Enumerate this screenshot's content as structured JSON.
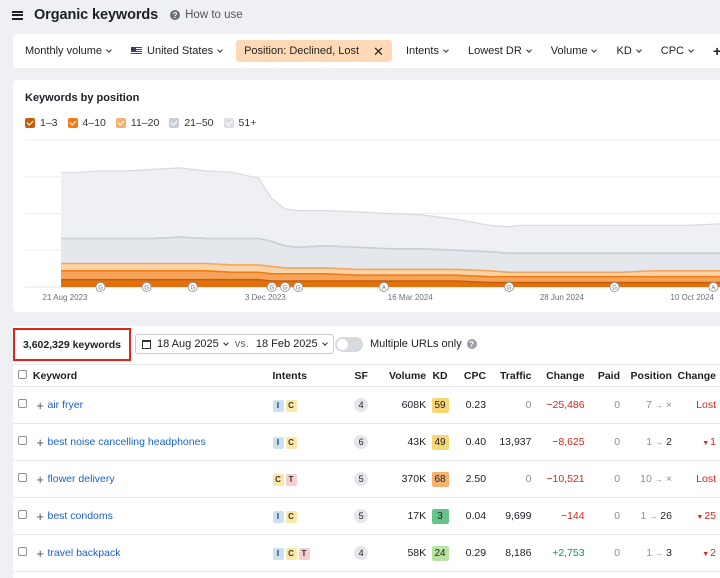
{
  "header": {
    "title": "Organic keywords",
    "how_to_use": "How to use"
  },
  "filters": {
    "monthly_volume": "Monthly volume",
    "country": "United States",
    "position_filter": "Position: Declined, Lost",
    "intents": "Intents",
    "lowest_dr": "Lowest DR",
    "volume": "Volume",
    "kd": "KD",
    "cpc": "CPC",
    "add_more": "A"
  },
  "chart_data": {
    "type": "area",
    "title": "Keywords by position",
    "legend": [
      {
        "name": "1–3",
        "color": "#c6600b"
      },
      {
        "name": "4–10",
        "color": "#ef7c16"
      },
      {
        "name": "11–20",
        "color": "#f7b26a"
      },
      {
        "name": "21–50",
        "color": "#c8ced6"
      },
      {
        "name": "51+",
        "color": "#dde1e6"
      }
    ],
    "x_ticks": [
      "21 Aug 2023",
      "3 Dec 2023",
      "16 Mar 2024",
      "28 Jun 2024",
      "10 Oct 2024"
    ],
    "x": [
      0,
      0.03,
      0.06,
      0.1,
      0.14,
      0.18,
      0.22,
      0.26,
      0.3,
      0.32,
      0.34,
      0.36,
      0.4,
      0.45,
      0.5,
      0.55,
      0.6,
      0.65,
      0.68,
      0.7,
      0.75,
      0.8,
      0.85,
      0.9,
      0.95,
      1.0
    ],
    "series": [
      {
        "name": "51+",
        "values": [
          0.78,
          0.78,
          0.79,
          0.79,
          0.8,
          0.81,
          0.79,
          0.78,
          0.74,
          0.6,
          0.53,
          0.52,
          0.52,
          0.51,
          0.5,
          0.49,
          0.46,
          0.42,
          0.41,
          0.42,
          0.42,
          0.42,
          0.42,
          0.42,
          0.42,
          0.43
        ]
      },
      {
        "name": "21–50",
        "values": [
          0.33,
          0.33,
          0.33,
          0.33,
          0.33,
          0.34,
          0.33,
          0.33,
          0.33,
          0.31,
          0.28,
          0.27,
          0.28,
          0.27,
          0.26,
          0.26,
          0.25,
          0.24,
          0.23,
          0.23,
          0.23,
          0.23,
          0.23,
          0.23,
          0.23,
          0.23
        ]
      },
      {
        "name": "11–20",
        "values": [
          0.16,
          0.16,
          0.16,
          0.16,
          0.16,
          0.16,
          0.16,
          0.15,
          0.15,
          0.14,
          0.13,
          0.13,
          0.13,
          0.12,
          0.12,
          0.12,
          0.12,
          0.11,
          0.1,
          0.1,
          0.1,
          0.1,
          0.1,
          0.11,
          0.11,
          0.11
        ]
      },
      {
        "name": "4–10",
        "values": [
          0.11,
          0.11,
          0.11,
          0.11,
          0.11,
          0.11,
          0.11,
          0.1,
          0.1,
          0.09,
          0.09,
          0.09,
          0.09,
          0.08,
          0.08,
          0.08,
          0.08,
          0.07,
          0.07,
          0.07,
          0.07,
          0.07,
          0.07,
          0.07,
          0.07,
          0.07
        ]
      },
      {
        "name": "1–3",
        "values": [
          0.05,
          0.05,
          0.05,
          0.05,
          0.05,
          0.05,
          0.05,
          0.05,
          0.05,
          0.04,
          0.04,
          0.04,
          0.04,
          0.04,
          0.04,
          0.04,
          0.04,
          0.03,
          0.03,
          0.03,
          0.03,
          0.03,
          0.03,
          0.03,
          0.03,
          0.03
        ]
      }
    ],
    "markers": [
      {
        "x": 0.06,
        "label": "G"
      },
      {
        "x": 0.13,
        "label": "G"
      },
      {
        "x": 0.2,
        "label": "G"
      },
      {
        "x": 0.32,
        "label": "G"
      },
      {
        "x": 0.34,
        "label": "G"
      },
      {
        "x": 0.36,
        "label": "G"
      },
      {
        "x": 0.49,
        "label": "A"
      },
      {
        "x": 0.68,
        "label": "G"
      },
      {
        "x": 0.84,
        "label": "G"
      },
      {
        "x": 0.99,
        "label": "A"
      }
    ]
  },
  "summary": {
    "keyword_count": "3,602,329 keywords",
    "date_from": "18 Aug 2025",
    "vs": "vs.",
    "date_to": "18 Feb 2025",
    "multiple_urls": "Multiple URLs only"
  },
  "table": {
    "headers": {
      "keyword": "Keyword",
      "intents": "Intents",
      "sf": "SF",
      "volume": "Volume",
      "kd": "KD",
      "cpc": "CPC",
      "traffic": "Traffic",
      "change": "Change",
      "paid": "Paid",
      "position": "Position",
      "pos_change": "Change"
    },
    "rows": [
      {
        "keyword": "air fryer",
        "intents": [
          "I",
          "C"
        ],
        "sf": "4",
        "volume": "608K",
        "kd": "59",
        "kd_color": "#f7d774",
        "cpc": "0.23",
        "traffic": "0",
        "change": "−25,486",
        "change_type": "neg",
        "paid": "0",
        "pos_from": "7",
        "pos_to": "×",
        "pos_change": "Lost"
      },
      {
        "keyword": "best noise cancelling headphones",
        "intents": [
          "I",
          "C"
        ],
        "sf": "6",
        "volume": "43K",
        "kd": "49",
        "kd_color": "#f7d774",
        "cpc": "0.40",
        "traffic": "13,937",
        "change": "−8,625",
        "change_type": "neg",
        "paid": "0",
        "pos_from": "1",
        "pos_to": "2",
        "pos_change": "1"
      },
      {
        "keyword": "flower delivery",
        "intents": [
          "C",
          "T"
        ],
        "sf": "5",
        "volume": "370K",
        "kd": "68",
        "kd_color": "#f6b26b",
        "cpc": "2.50",
        "traffic": "0",
        "change": "−10,521",
        "change_type": "neg",
        "paid": "0",
        "pos_from": "10",
        "pos_to": "×",
        "pos_change": "Lost"
      },
      {
        "keyword": "best condoms",
        "intents": [
          "I",
          "C"
        ],
        "sf": "5",
        "volume": "17K",
        "kd": "3",
        "kd_color": "#66c48a",
        "cpc": "0.04",
        "traffic": "9,699",
        "change": "−144",
        "change_type": "neg",
        "paid": "0",
        "pos_from": "1",
        "pos_to": "26",
        "pos_change": "25"
      },
      {
        "keyword": "travel backpack",
        "intents": [
          "I",
          "C",
          "T"
        ],
        "sf": "4",
        "volume": "58K",
        "kd": "24",
        "kd_color": "#b9e3a0",
        "cpc": "0.29",
        "traffic": "8,186",
        "change": "+2,753",
        "change_type": "pos",
        "paid": "0",
        "pos_from": "1",
        "pos_to": "3",
        "pos_change": "2"
      }
    ]
  },
  "intent_colors": {
    "I": "#c9e1f7",
    "C": "#fbe8a6",
    "T": "#f7cfcf"
  }
}
